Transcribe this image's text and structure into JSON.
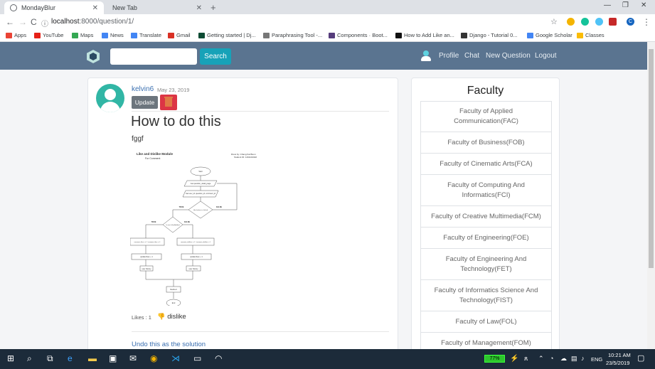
{
  "browser": {
    "tabs": [
      {
        "label": "MondayBlur",
        "active": true
      },
      {
        "label": "New Tab",
        "active": false
      }
    ],
    "new_tab_symbol": "+",
    "window_controls": [
      "—",
      "❐",
      "✕"
    ],
    "url_host": "localhost",
    "url_path": ":8000/question/1/",
    "bookmarks": [
      "Apps",
      "YouTube",
      "Maps",
      "News",
      "Translate",
      "Gmail",
      "Getting started | Dj...",
      "Paraphrasing Tool -...",
      "Components · Boot...",
      "How to Add Like an...",
      "Django - Tutorial 0...",
      "Google Scholar",
      "Classes"
    ],
    "profile_initial": "C"
  },
  "navbar": {
    "search_button": "Search",
    "links": [
      "Profile",
      "Chat",
      "New Question",
      "Logout"
    ]
  },
  "question": {
    "author": "kelvin6",
    "date": "May 23, 2019",
    "update_label": "Update",
    "title": "How to do this",
    "body": "fggf",
    "likes_text": "Likes : 1",
    "dislike_label": "dislike",
    "undo_label": "Undo this as the solution"
  },
  "flowchart": {
    "title": "Like and Dislike Module",
    "subtitle": "For Comment",
    "drawn_by": "Drew by: Chang Kai Boon",
    "student_id": "Student ID: 1161101022",
    "nodes": [
      "Start",
      "Get question_detail_page",
      "Get user_id, question_id, comment_id",
      "Has button is clicked",
      "Is user's liked/disliked",
      "comment_likes += 1 / comment_likes -= 1",
      "comment_dislikes += 1 / comment_dislikes -= 1",
      "update likes + 1",
      "update likes + 1",
      "user history",
      "user history",
      "Redirect",
      "End"
    ],
    "labels": [
      "TRUE",
      "FALSE",
      "TRUE",
      "FALSE"
    ]
  },
  "sidebar": {
    "title": "Faculty",
    "faculties": [
      "Faculty of Applied Communication(FAC)",
      "Faculty of Business(FOB)",
      "Faculty of Cinematic Arts(FCA)",
      "Faculty of Computing And Informatics(FCI)",
      "Faculty of Creative Multimedia(FCM)",
      "Faculty of Engineering(FOE)",
      "Faculty of Engineering And Technology(FET)",
      "Faculty of Informatics Science And Technology(FIST)",
      "Faculty of Law(FOL)",
      "Faculty of Management(FOM)"
    ]
  },
  "taskbar": {
    "battery": "77%",
    "language": "ENG",
    "time": "10:21 AM",
    "date": "23/5/2019"
  },
  "colors": {
    "navbar": "#5a7490",
    "search_button": "#17a2b8",
    "delete_button": "#dc3545",
    "update_button": "#6c757d",
    "link": "#3a6fb0",
    "avatar": "#31b6a5"
  }
}
